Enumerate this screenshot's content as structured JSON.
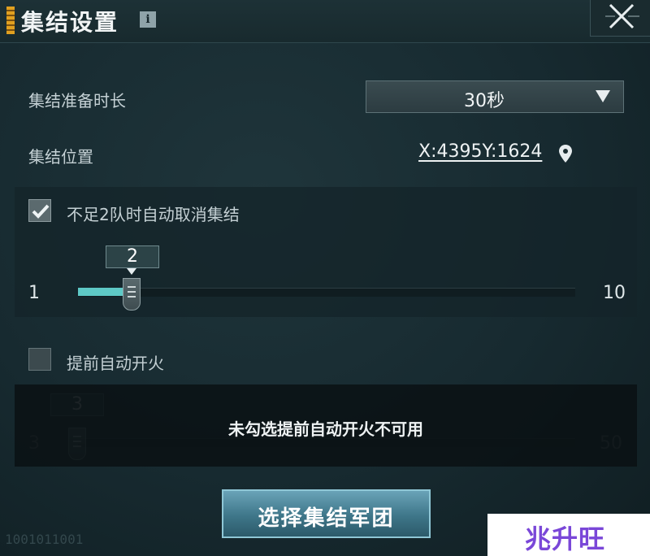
{
  "header": {
    "title": "集结设置",
    "info_icon": "i"
  },
  "prep_time": {
    "label": "集结准备时长",
    "value": "30秒"
  },
  "location": {
    "label": "集结位置",
    "coords": "X:4395Y:1624"
  },
  "auto_cancel": {
    "label": "不足2队时自动取消集结",
    "checked": true,
    "slider": {
      "min": "1",
      "max": "10",
      "value": "2"
    }
  },
  "auto_fire": {
    "label": "提前自动开火",
    "checked": false,
    "slider": {
      "min": "3",
      "max": "50",
      "value": "3"
    },
    "disabled_message": "未勾选提前自动开火不可用"
  },
  "confirm_button": "选择集结军团",
  "decor_binary": "1001011001",
  "watermark": "兆升旺",
  "colors": {
    "accent": "#5ec9c6",
    "button": "#3e7689",
    "gold": "#e0a020"
  }
}
